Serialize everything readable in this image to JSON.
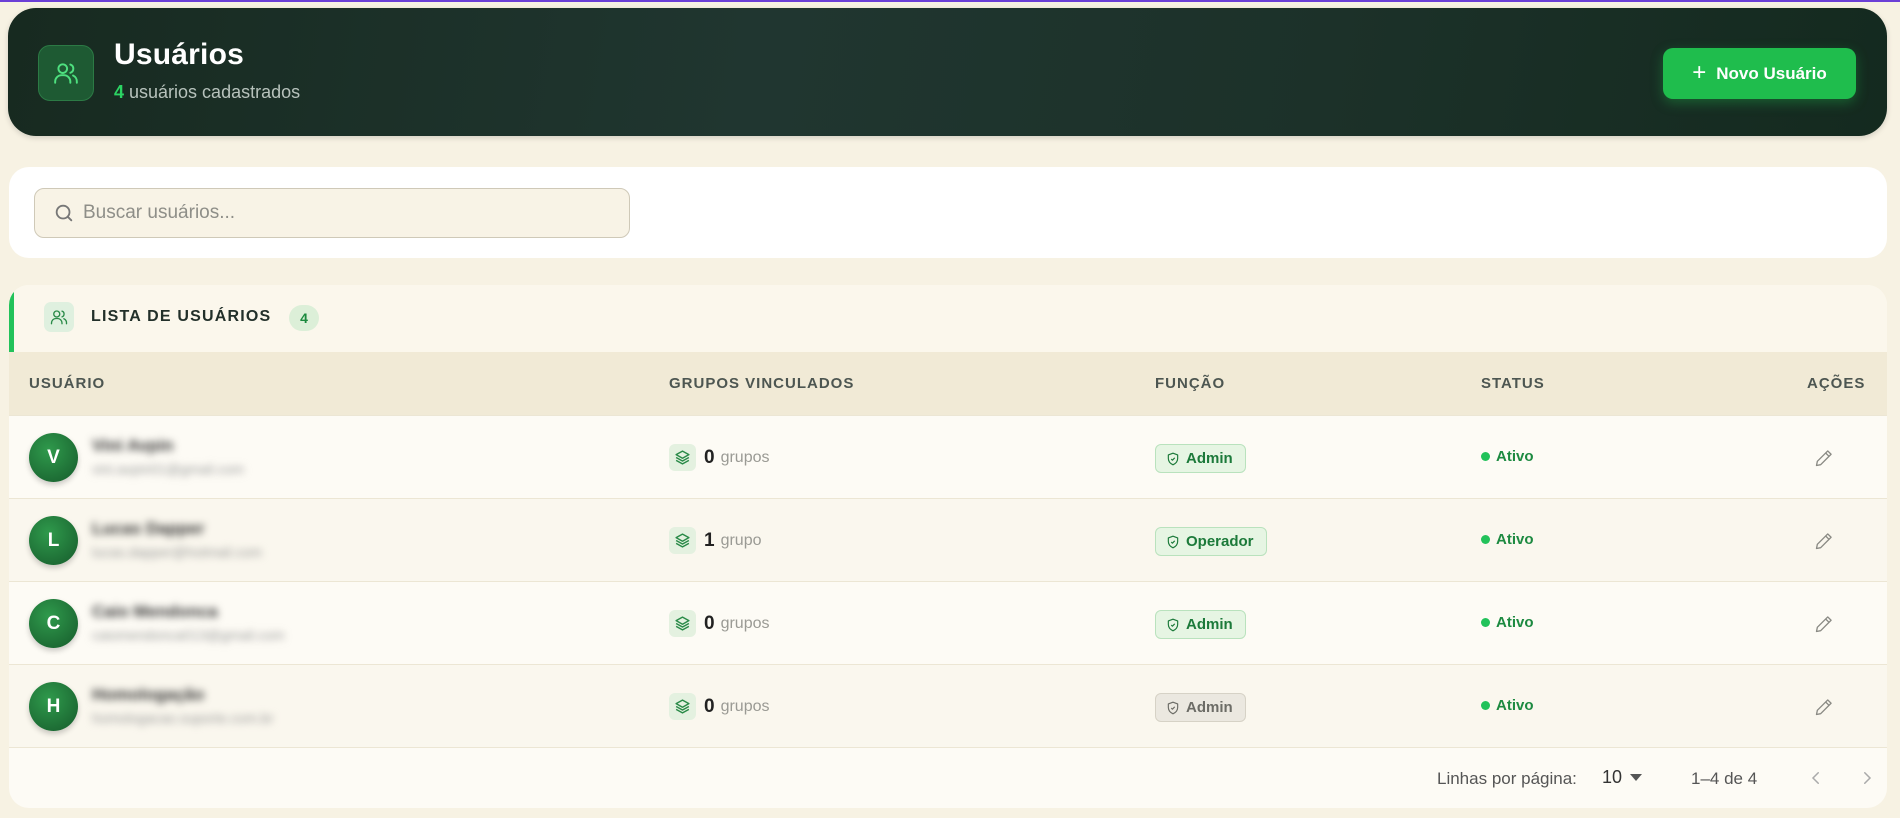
{
  "header": {
    "title": "Usuários",
    "user_count": "4",
    "subtitle": "usuários cadastrados",
    "new_button": "Novo Usuário",
    "icon": "users-icon"
  },
  "search": {
    "placeholder": "Buscar usuários...",
    "value": "",
    "icon": "search-icon"
  },
  "list": {
    "title": "LISTA DE USUÁRIOS",
    "count": "4",
    "columns": [
      "USUÁRIO",
      "GRUPOS VINCULADOS",
      "FUNÇÃO",
      "STATUS",
      "AÇÕES"
    ],
    "rows": [
      {
        "initial": "V",
        "name": "Vini Avpin",
        "email": "vini.avpin01@gmail.com",
        "groups": "0",
        "groups_label": "grupos",
        "role": "Admin",
        "role_style": "active",
        "status": "Ativo"
      },
      {
        "initial": "L",
        "name": "Lucas Dapper",
        "email": "lucas.dapper@hotmail.com",
        "groups": "1",
        "groups_label": "grupo",
        "role": "Operador",
        "role_style": "active",
        "status": "Ativo"
      },
      {
        "initial": "C",
        "name": "Caio Mendonca",
        "email": "caiomendonca013@gmail.com",
        "groups": "0",
        "groups_label": "grupos",
        "role": "Admin",
        "role_style": "active",
        "status": "Ativo"
      },
      {
        "initial": "H",
        "name": "Homologação",
        "email": "homologacao.suporte.com.br",
        "groups": "0",
        "groups_label": "grupos",
        "role": "Admin",
        "role_style": "muted",
        "status": "Ativo"
      }
    ]
  },
  "pagination": {
    "rows_label": "Linhas por página:",
    "rows_value": "10",
    "range": "1–4 de 4"
  },
  "colors": {
    "accent": "#1fbd4d",
    "header_bg": "#1c3129",
    "page_bg": "#f7f2e3"
  }
}
